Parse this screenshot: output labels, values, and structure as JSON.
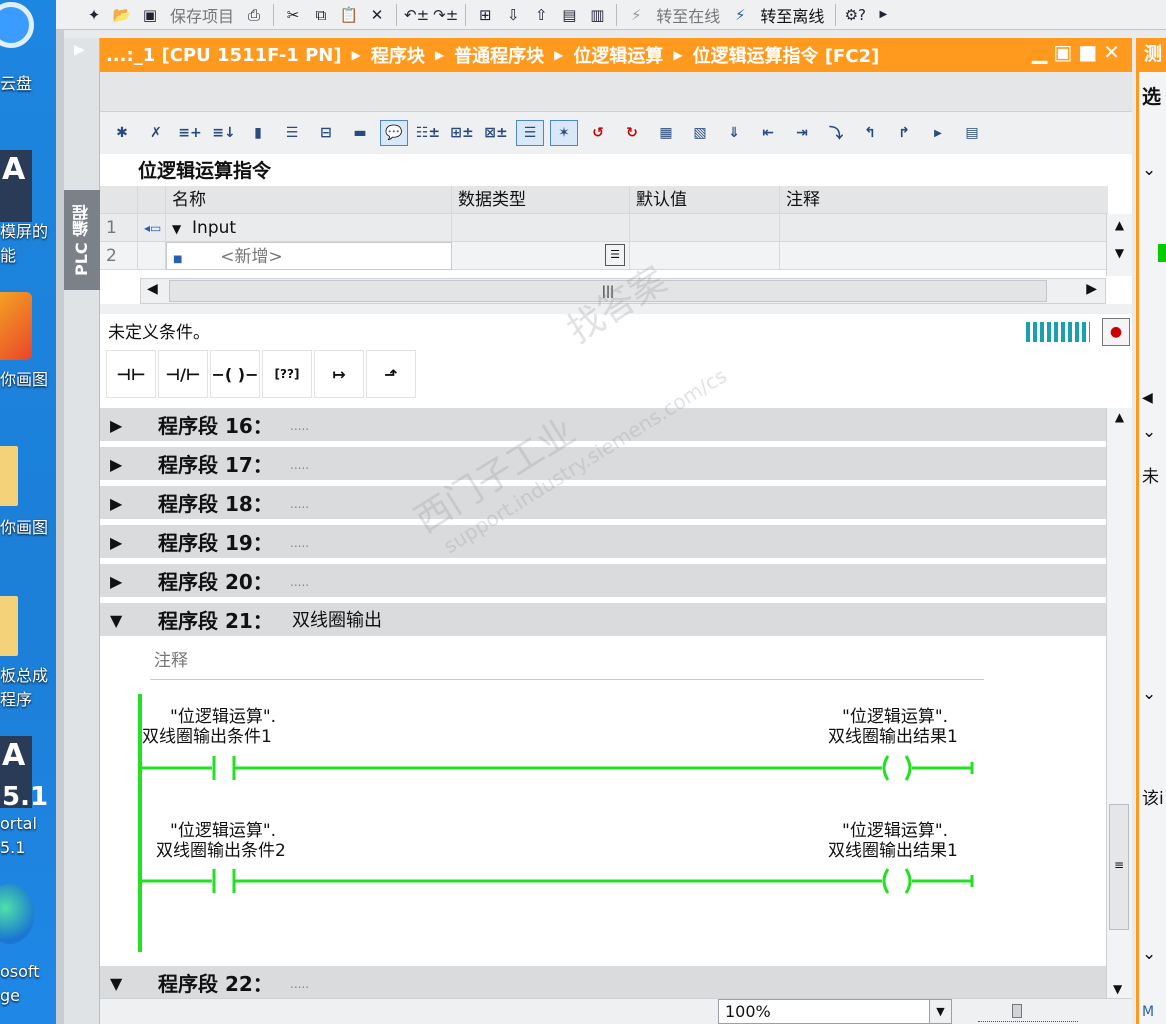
{
  "desktop": {
    "items": [
      {
        "label": "云盘",
        "icon": "cloud-disk-icon"
      },
      {
        "label": "模屏的",
        "label2": "能",
        "icon": "tia-portal-icon"
      },
      {
        "label": "你画图",
        "icon": "paint-icon"
      },
      {
        "label": "你画图",
        "icon": "folder-icon"
      },
      {
        "label": "板总成",
        "label2": "程序",
        "icon": "folder-icon"
      },
      {
        "label": "ortal",
        "label2": "5.1",
        "icon": "tia-portal-icon",
        "badge": "A",
        "badge2": "5.1"
      },
      {
        "label": "osoft",
        "label2": "ge",
        "icon": "edge-icon"
      }
    ]
  },
  "toolbar": {
    "save_project": "保存项目",
    "go_online": "转至在线",
    "go_offline": "转至离线"
  },
  "window": {
    "breadcrumb": [
      "...:_1 [CPU 1511F-1 PN]",
      "程序块",
      "普通程序块",
      "位逻辑运算",
      "位逻辑运算指令 [FC2]"
    ],
    "nav_title": "PLC 编程",
    "right_header": "测",
    "right_tab": "选",
    "right_labels": [
      "未",
      "该i",
      "M"
    ]
  },
  "block": {
    "title": "位逻辑运算指令",
    "columns": [
      "名称",
      "数据类型",
      "默认值",
      "注释"
    ],
    "rows": [
      {
        "num": "1",
        "name": "Input"
      },
      {
        "num": "2",
        "name": "<新增>"
      }
    ]
  },
  "editor": {
    "condition": "未定义条件。",
    "comment_placeholder": "注释",
    "networks": [
      {
        "label": "程序段 16：",
        "dots": "....."
      },
      {
        "label": "程序段 17：",
        "dots": "....."
      },
      {
        "label": "程序段 18：",
        "dots": "....."
      },
      {
        "label": "程序段 19：",
        "dots": "....."
      },
      {
        "label": "程序段 20：",
        "dots": "....."
      },
      {
        "label": "程序段 21：",
        "title": "双线圈输出"
      },
      {
        "label": "程序段 22：",
        "dots": "....."
      }
    ],
    "rungs": [
      {
        "contact_db": "\"位逻辑运算\".",
        "contact_tag": "双线圈输出条件1",
        "coil_db": "\"位逻辑运算\".",
        "coil_tag": "双线圈输出结果1"
      },
      {
        "contact_db": "\"位逻辑运算\".",
        "contact_tag": "双线圈输出条件2",
        "coil_db": "\"位逻辑运算\".",
        "coil_tag": "双线圈输出结果1"
      }
    ]
  },
  "zoom": "100%",
  "watermark": [
    "西门子工业",
    "找答案",
    "support.industry.siemens.com/cs"
  ],
  "colors": {
    "title_orange": "#ff9a1f",
    "rung_green": "#22e022",
    "desktop_blue": "#1d86e0"
  }
}
